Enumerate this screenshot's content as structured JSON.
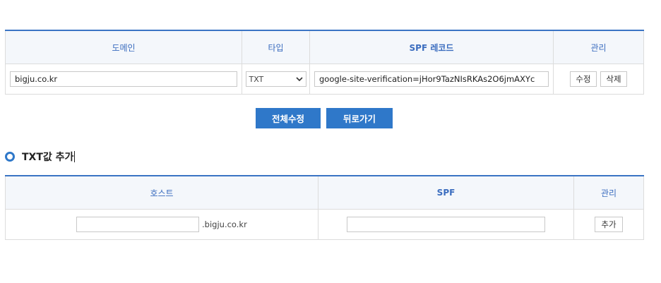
{
  "records_table": {
    "headers": [
      "도메인",
      "타입",
      "SPF 레코드",
      "관리"
    ],
    "row": {
      "domain": "bigju.co.kr",
      "type": "TXT",
      "record": "google-site-verification=jHor9TazNIsRKAs2O6jmAXYc",
      "edit_label": "수정",
      "delete_label": "삭제"
    }
  },
  "actions": {
    "edit_all_label": "전체수정",
    "back_label": "뒤로가기"
  },
  "add_section": {
    "title": "TXT값 추가",
    "headers": [
      "호스트",
      "SPF",
      "관리"
    ],
    "host_placeholder": "",
    "domain_suffix": ".bigju.co.kr",
    "spf_placeholder": "",
    "add_label": "추가"
  },
  "colors": {
    "accent": "#2f78c9",
    "header_bg": "#f4f7fb",
    "header_text": "#3b6dbf"
  }
}
